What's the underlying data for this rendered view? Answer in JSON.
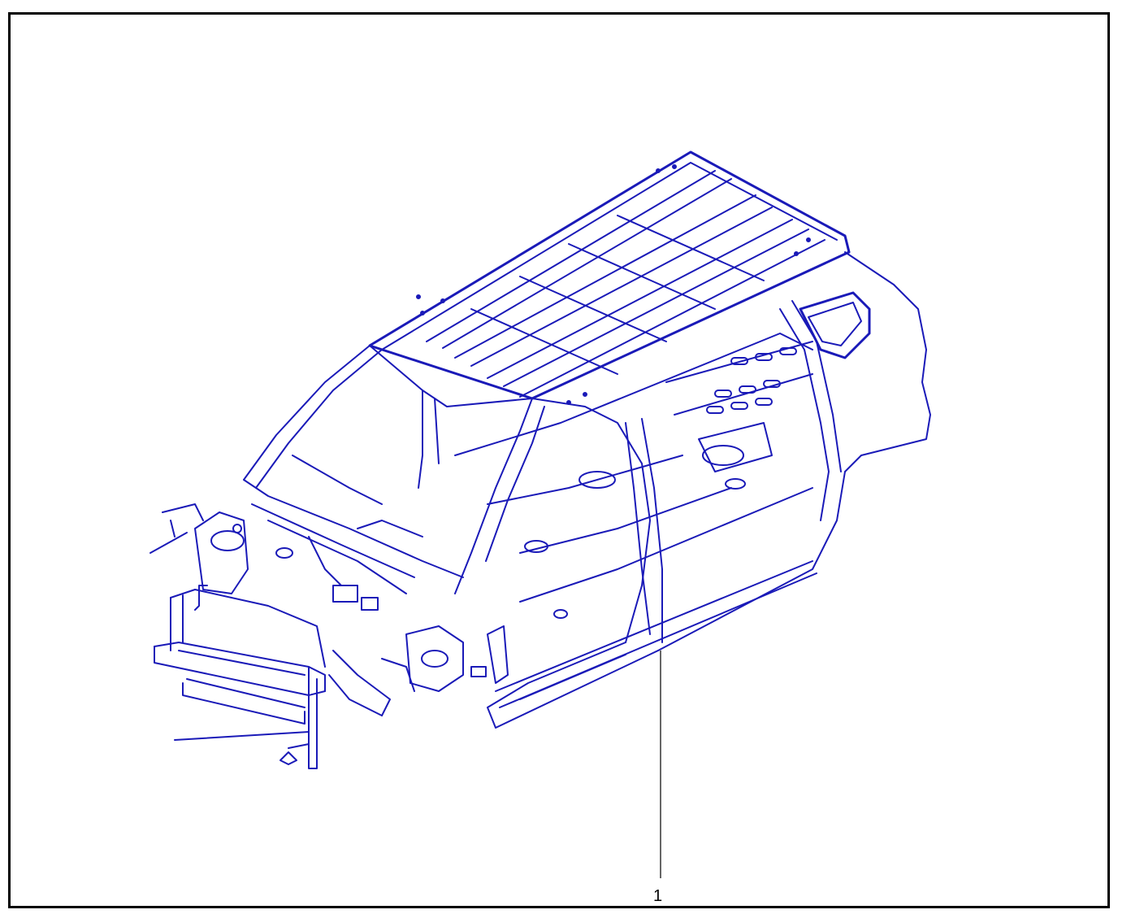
{
  "callouts": [
    {
      "number": "1"
    }
  ],
  "colors": {
    "linework": "#1a1ab8",
    "frame": "#000000",
    "background": "#ffffff"
  }
}
